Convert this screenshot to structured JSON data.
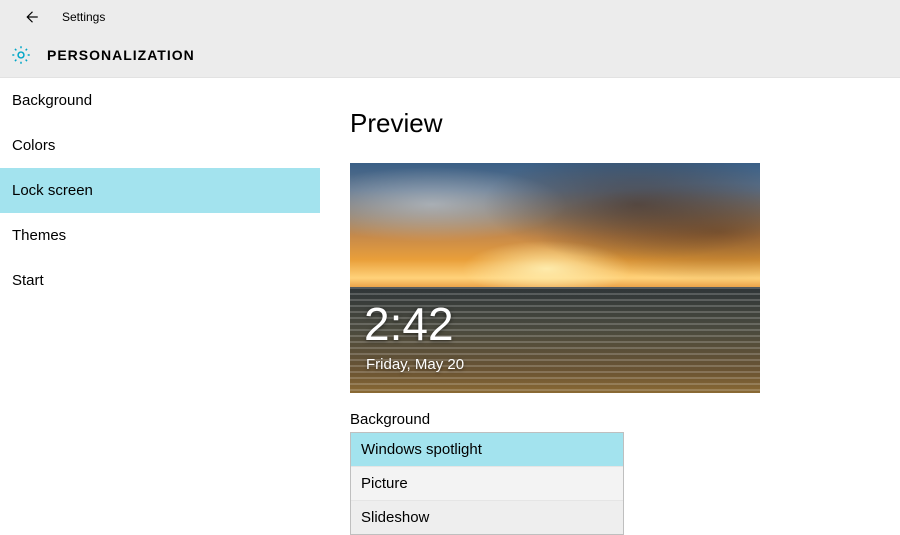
{
  "window": {
    "title": "Settings"
  },
  "header": {
    "title": "PERSONALIZATION"
  },
  "sidebar": {
    "items": [
      {
        "label": "Background",
        "active": false
      },
      {
        "label": "Colors",
        "active": false
      },
      {
        "label": "Lock screen",
        "active": true
      },
      {
        "label": "Themes",
        "active": false
      },
      {
        "label": "Start",
        "active": false
      }
    ]
  },
  "main": {
    "preview_title": "Preview",
    "preview_time": "2:42",
    "preview_date": "Friday, May 20",
    "background_label": "Background",
    "background_options": [
      {
        "label": "Windows spotlight",
        "selected": true
      },
      {
        "label": "Picture",
        "selected": false
      },
      {
        "label": "Slideshow",
        "selected": false
      }
    ]
  }
}
